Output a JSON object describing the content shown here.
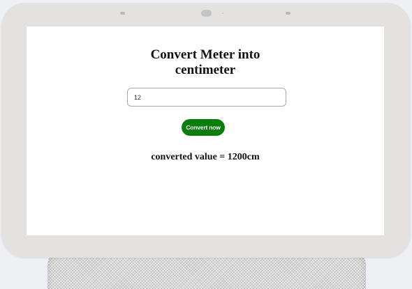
{
  "converter": {
    "title": "Convert Meter into centimeter",
    "input_value": "12",
    "button_label": "Convert now",
    "result_text": "converted value = 1200cm"
  },
  "colors": {
    "button_background": "#0b7d0b",
    "device_frame": "#e3e2e0",
    "screen_background": "#ffffff"
  }
}
